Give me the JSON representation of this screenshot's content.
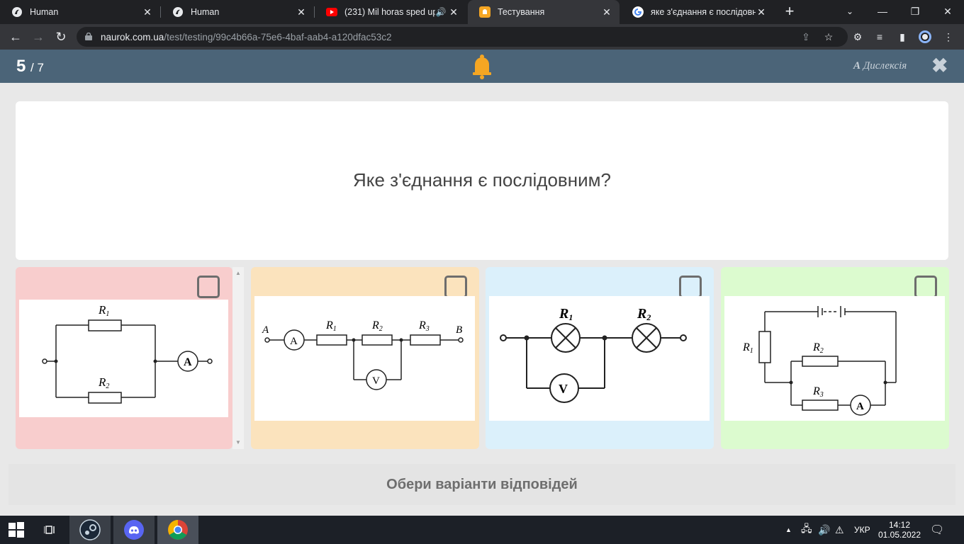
{
  "browser": {
    "tabs": [
      {
        "title": "Human",
        "favicon": "bird-icon"
      },
      {
        "title": "Human",
        "favicon": "bird-icon"
      },
      {
        "title": "(231) Mil horas sped up",
        "favicon": "youtube-icon"
      },
      {
        "title": "Тестування",
        "favicon": "naurok-icon"
      },
      {
        "title": "яке з'єднання є послідовни",
        "favicon": "google-icon"
      }
    ],
    "url_host": "naurok.com.ua",
    "url_path": "/test/testing/99c4b66a-75e6-4baf-aab4-a120dfac53c2"
  },
  "header": {
    "current": "5",
    "total": "/ 7",
    "dyslexia_label": "Дислексія",
    "dyslexia_glyph": "A"
  },
  "question": {
    "text": "Яке з'єднання є послідовним?"
  },
  "options": [
    {
      "color": "#f8cdcd",
      "labels": {
        "r1": "R",
        "r1s": "1",
        "r2": "R",
        "r2s": "2",
        "a": "A"
      }
    },
    {
      "color": "#fbe3bd",
      "labels": {
        "a_pt": "A",
        "b_pt": "B",
        "amm": "A",
        "r1": "R",
        "r1s": "1",
        "r2": "R",
        "r2s": "2",
        "r3": "R",
        "r3s": "3",
        "v": "V"
      }
    },
    {
      "color": "#dbf0fb",
      "labels": {
        "r1": "R",
        "r1s": "1",
        "r2": "R",
        "r2s": "2",
        "v": "V"
      }
    },
    {
      "color": "#dcfbcf",
      "labels": {
        "r1": "R",
        "r1s": "1",
        "r2": "R",
        "r2s": "2",
        "r3": "R",
        "r3s": "3",
        "a": "A"
      }
    }
  ],
  "footer": {
    "text": "Обери варіанти відповідей"
  },
  "taskbar": {
    "lang": "УКР",
    "time": "14:12",
    "date": "01.05.2022"
  }
}
